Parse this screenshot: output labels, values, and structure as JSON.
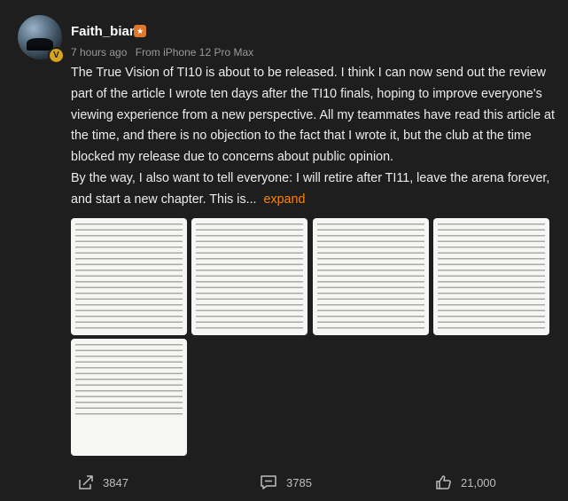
{
  "post": {
    "username": "Faith_bian",
    "timestamp": "7 hours ago",
    "source": "From iPhone 12 Pro Max",
    "paragraphs": [
      "The True Vision of TI10 is about to be released. I think I can now send out the review part of the article I wrote ten days after the TI10 finals, hoping to improve everyone's viewing experience from a new perspective. All my teammates have read this article at the time, and there is no objection to the fact that I wrote it, but the club at the time blocked my release due to concerns about public opinion.",
      "By the way, I also want to tell everyone: I will retire after TI11, leave the arena forever, and start a new chapter. This is..."
    ],
    "expand_label": "expand",
    "image_count": 5,
    "icons": [
      "verified-badge-icon",
      "level-badge-icon",
      "share-icon",
      "comment-icon",
      "like-icon"
    ]
  },
  "actions": {
    "shares": "3847",
    "comments": "3785",
    "likes": "21,000"
  },
  "colors": {
    "background": "#1e1e1e",
    "accent": "#ff8200",
    "text": "#ececec",
    "muted": "#9a9a9a"
  }
}
